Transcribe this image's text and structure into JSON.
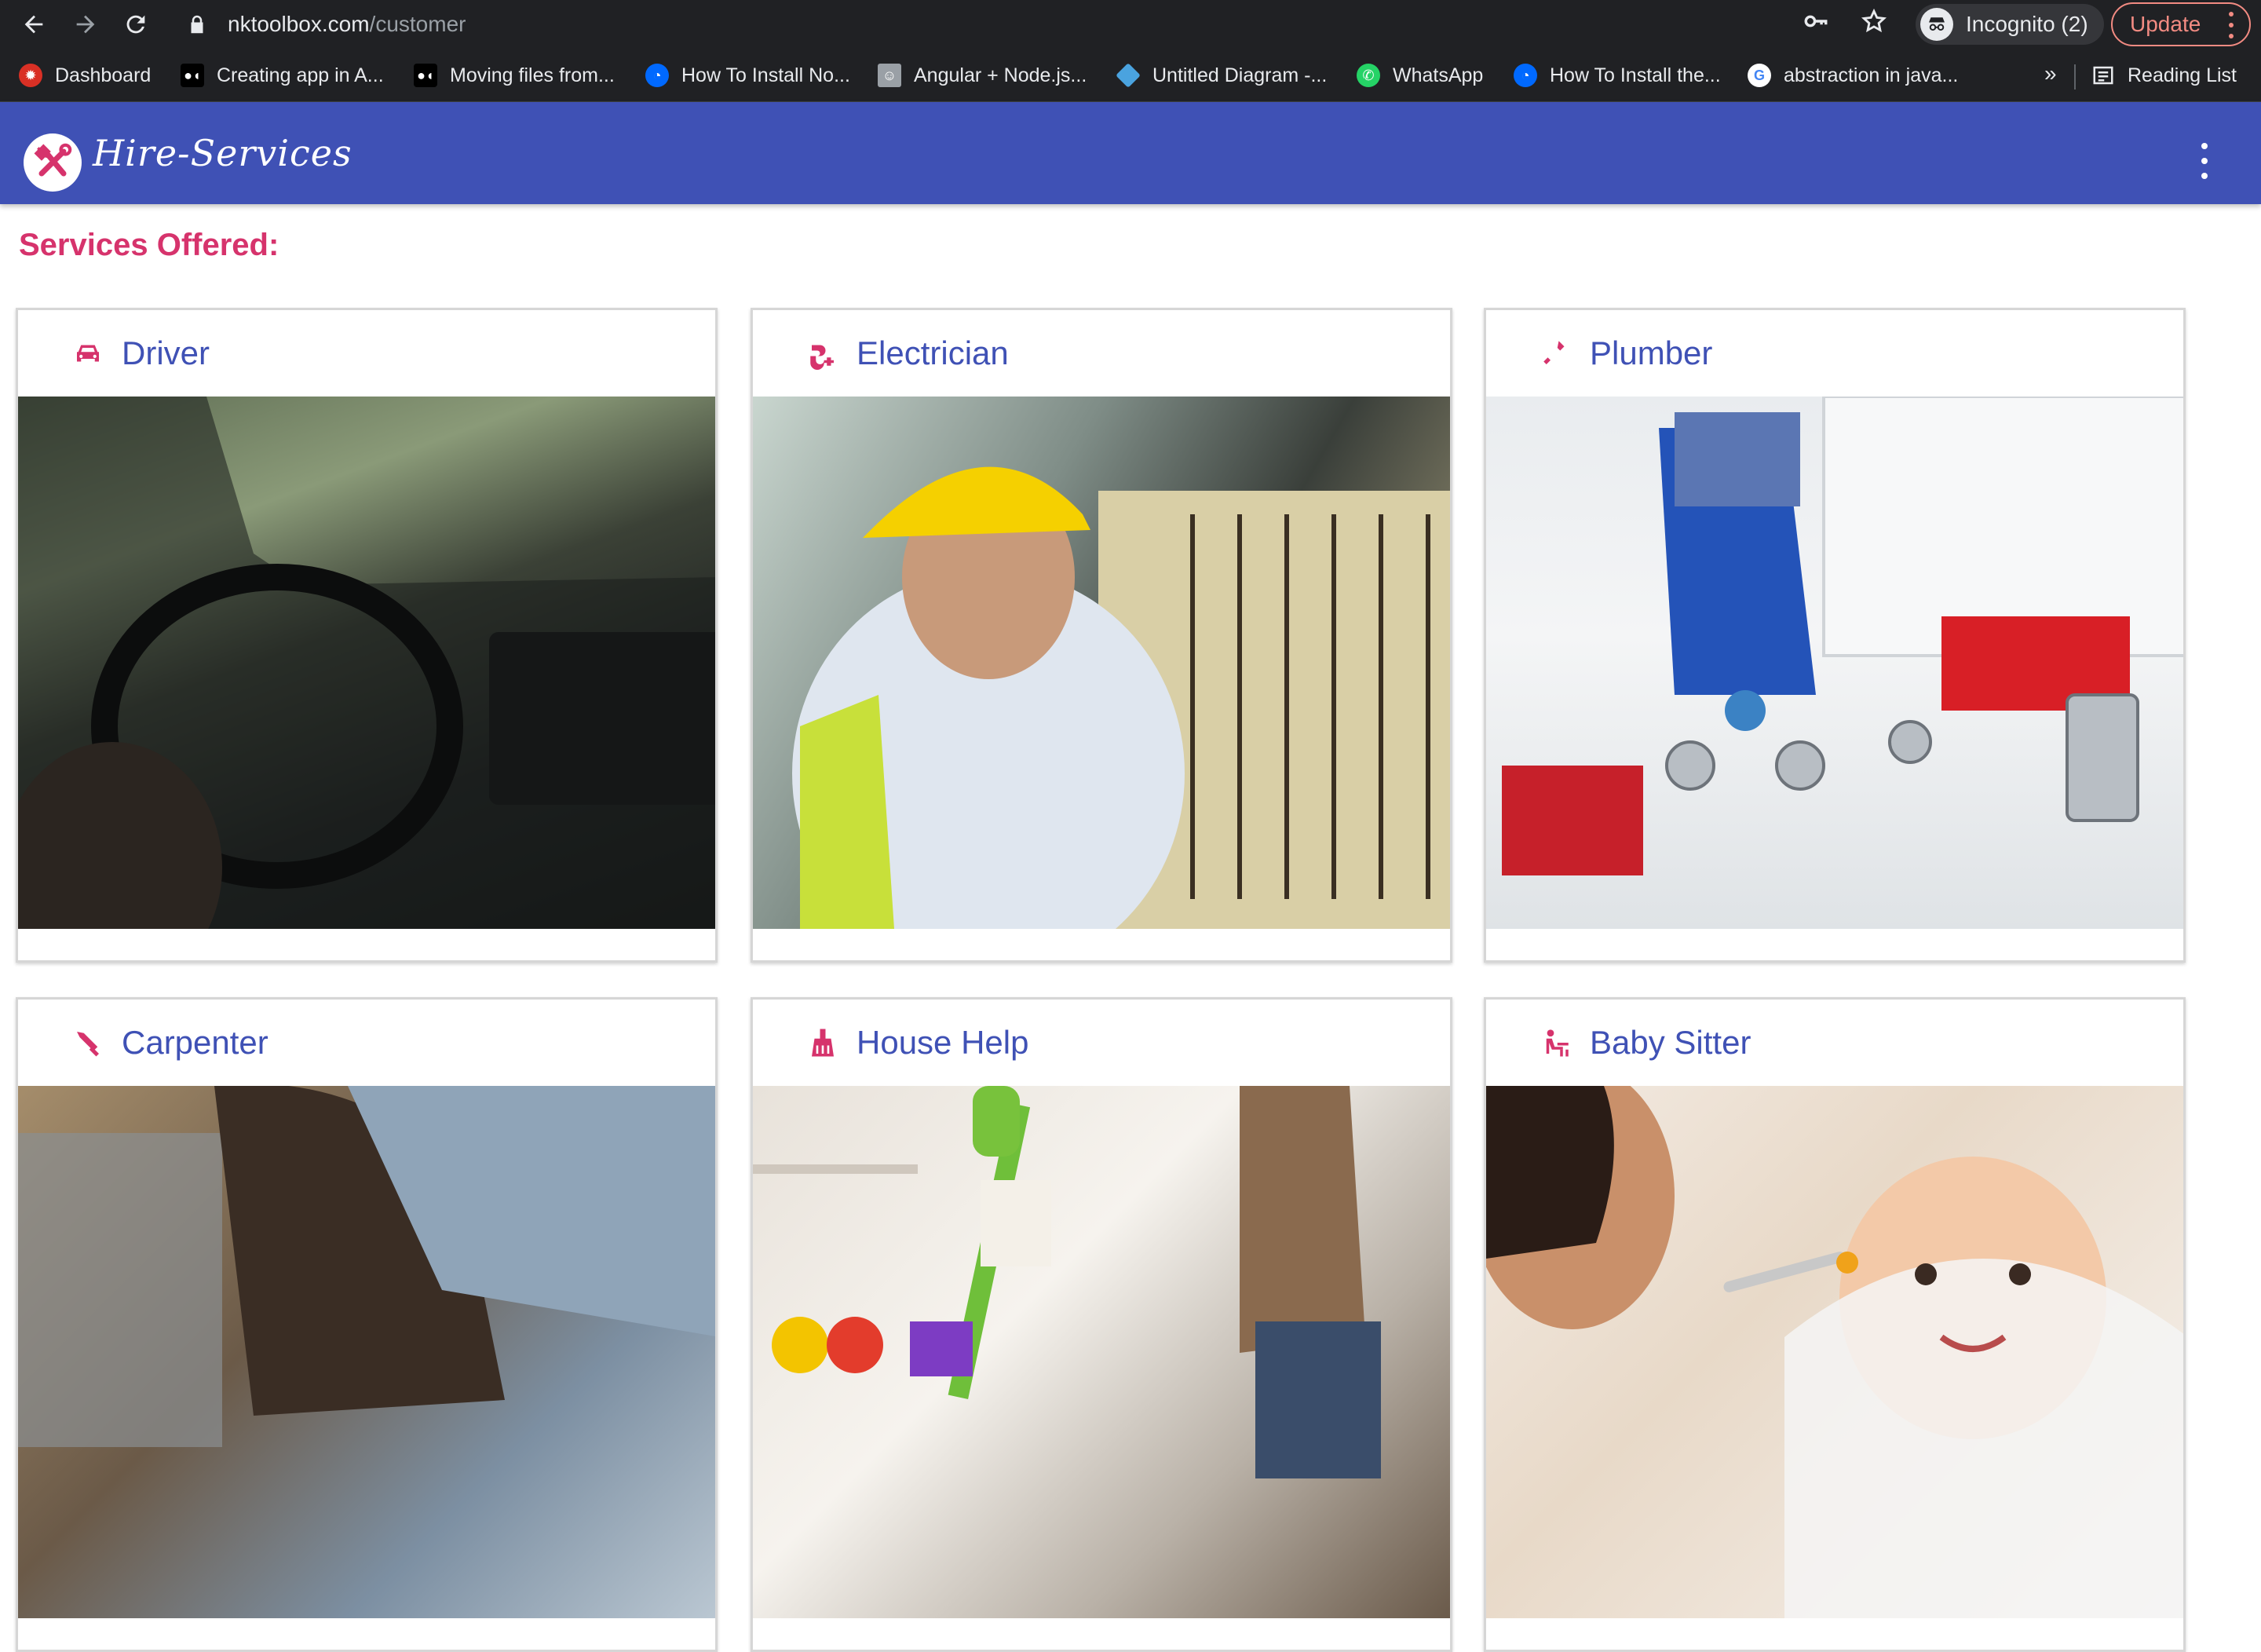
{
  "browser": {
    "url_host": "nktoolbox.com",
    "url_path": "/customer",
    "incognito_label": "Incognito (2)",
    "update_label": "Update",
    "more_bookmarks": "»",
    "reading_list": "Reading List",
    "bookmarks": [
      {
        "label": "Dashboard",
        "icon": "red-app-icon"
      },
      {
        "label": "Creating app in A...",
        "icon": "medium-icon"
      },
      {
        "label": "Moving files from...",
        "icon": "medium-icon"
      },
      {
        "label": "How To Install No...",
        "icon": "digitalocean-icon"
      },
      {
        "label": "Angular + Node.js...",
        "icon": "avatar-icon"
      },
      {
        "label": "Untitled Diagram -...",
        "icon": "drawio-icon"
      },
      {
        "label": "WhatsApp",
        "icon": "whatsapp-icon"
      },
      {
        "label": "How To Install the...",
        "icon": "digitalocean-icon"
      },
      {
        "label": "abstraction in java...",
        "icon": "google-icon"
      }
    ]
  },
  "app": {
    "brand": "Hire-Services",
    "section_title": "Services Offered:",
    "accent_color": "#d6336c",
    "primary_color": "#3f51b5"
  },
  "services": [
    {
      "title": "Driver",
      "icon": "car-icon",
      "image": "driver-photo"
    },
    {
      "title": "Electrician",
      "icon": "plug-icon",
      "image": "electrician-photo"
    },
    {
      "title": "Plumber",
      "icon": "wrench-icon",
      "image": "plumber-photo"
    },
    {
      "title": "Carpenter",
      "icon": "hammer-icon",
      "image": "carpenter-photo"
    },
    {
      "title": "House Help",
      "icon": "broom-icon",
      "image": "house-help-photo"
    },
    {
      "title": "Baby Sitter",
      "icon": "baby-icon",
      "image": "baby-sitter-photo"
    }
  ]
}
